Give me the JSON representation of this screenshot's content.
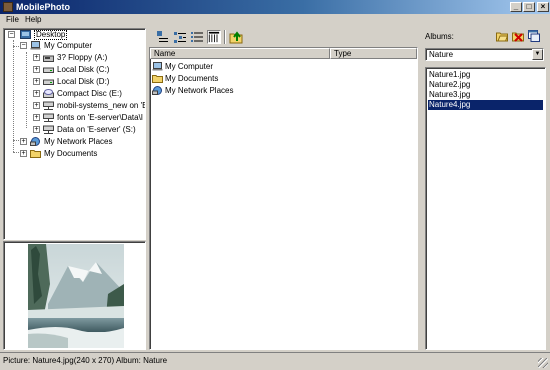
{
  "window": {
    "title": "MobilePhoto",
    "minimize": "_",
    "maximize": "□",
    "close": "×"
  },
  "menu": [
    {
      "label": "File"
    },
    {
      "label": "Help"
    }
  ],
  "tree": {
    "root": "Desktop",
    "my_computer": "My Computer",
    "drives": [
      {
        "label": "3? Floppy (A:)",
        "icon": "floppy-icon"
      },
      {
        "label": "Local Disk (C:)",
        "icon": "hard-disk-icon"
      },
      {
        "label": "Local Disk (D:)",
        "icon": "hard-disk-icon"
      },
      {
        "label": "Compact Disc (E:)",
        "icon": "cd-drive-icon"
      },
      {
        "label": "mobil-systems_new on 'E",
        "icon": "network-drive-icon"
      },
      {
        "label": "fonts on 'E-server\\Data\\I",
        "icon": "network-drive-icon"
      },
      {
        "label": "Data on 'E-server' (S:)",
        "icon": "network-drive-icon"
      }
    ],
    "network": "My Network Places",
    "documents": "My Documents"
  },
  "file_list": {
    "columns": [
      "Name",
      "Type"
    ],
    "rows": [
      {
        "name": "My Computer",
        "icon": "computer-icon"
      },
      {
        "name": "My Documents",
        "icon": "folder-icon"
      },
      {
        "name": "My Network Places",
        "icon": "network-places-icon"
      }
    ]
  },
  "albums": {
    "label": "Albums:",
    "selected_album": "Nature",
    "pictures": [
      "Nature1.jpg",
      "Nature2.jpg",
      "Nature3.jpg",
      "Nature4.jpg"
    ],
    "selected_index": 3
  },
  "status": {
    "text": "Picture: Nature4.jpg(240 x 270)  Album: Nature"
  },
  "colors": {
    "selection": "#0a246a",
    "face": "#d4d0c8"
  }
}
